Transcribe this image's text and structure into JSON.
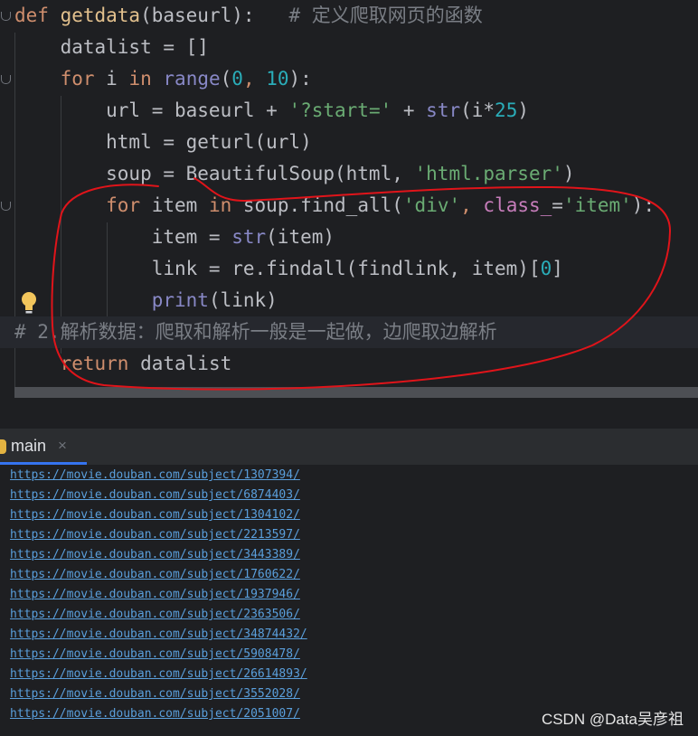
{
  "editor": {
    "lines": [
      [
        {
          "t": "def ",
          "c": "kw"
        },
        {
          "t": "getdata",
          "c": "fn"
        },
        {
          "t": "(baseurl):   ",
          "c": "param"
        },
        {
          "t": "# 定义爬取网页的函数",
          "c": "cm"
        }
      ],
      [
        {
          "t": "    datalist = []",
          "c": "param"
        }
      ],
      [
        {
          "t": "    ",
          "c": "param"
        },
        {
          "t": "for",
          "c": "kw"
        },
        {
          "t": " i ",
          "c": "param"
        },
        {
          "t": "in",
          "c": "kw"
        },
        {
          "t": " ",
          "c": "param"
        },
        {
          "t": "range",
          "c": "bi"
        },
        {
          "t": "(",
          "c": "param"
        },
        {
          "t": "0",
          "c": "num"
        },
        {
          "t": ", ",
          "c": "kw"
        },
        {
          "t": "10",
          "c": "num"
        },
        {
          "t": "):",
          "c": "param"
        }
      ],
      [
        {
          "t": "        url = baseurl + ",
          "c": "param"
        },
        {
          "t": "'?start='",
          "c": "str"
        },
        {
          "t": " + ",
          "c": "param"
        },
        {
          "t": "str",
          "c": "bi"
        },
        {
          "t": "(i*",
          "c": "param"
        },
        {
          "t": "25",
          "c": "num"
        },
        {
          "t": ")",
          "c": "param"
        }
      ],
      [
        {
          "t": "        html = geturl(url)",
          "c": "param"
        }
      ],
      [
        {
          "t": "        soup = BeautifulSoup(html, ",
          "c": "param"
        },
        {
          "t": "'html.parser'",
          "c": "str"
        },
        {
          "t": ")",
          "c": "param"
        }
      ],
      [
        {
          "t": "        ",
          "c": "param"
        },
        {
          "t": "for",
          "c": "kw"
        },
        {
          "t": " item ",
          "c": "param"
        },
        {
          "t": "in",
          "c": "kw"
        },
        {
          "t": " soup.find_all(",
          "c": "param"
        },
        {
          "t": "'div'",
          "c": "str"
        },
        {
          "t": ", ",
          "c": "kw"
        },
        {
          "t": "class_",
          "c": "attr"
        },
        {
          "t": "=",
          "c": "param"
        },
        {
          "t": "'item'",
          "c": "str"
        },
        {
          "t": "):",
          "c": "param"
        }
      ],
      [
        {
          "t": "            item = ",
          "c": "param"
        },
        {
          "t": "str",
          "c": "bi"
        },
        {
          "t": "(item)",
          "c": "param"
        }
      ],
      [
        {
          "t": "            link = re.findall(findlink, item)[",
          "c": "param"
        },
        {
          "t": "0",
          "c": "num"
        },
        {
          "t": "]",
          "c": "param"
        }
      ],
      [
        {
          "t": "            ",
          "c": "param"
        },
        {
          "t": "print",
          "c": "bi"
        },
        {
          "t": "(link)",
          "c": "param"
        }
      ],
      [
        {
          "t": "# 2.解析数据：爬取和解析一般是一起做，边爬取边解析",
          "c": "cm"
        }
      ],
      [
        {
          "t": "    ",
          "c": "param"
        },
        {
          "t": "return",
          "c": "kw"
        },
        {
          "t": " datalist",
          "c": "param"
        }
      ]
    ]
  },
  "run_panel": {
    "tab_label": "main",
    "close_glyph": "×"
  },
  "console": {
    "output": [
      "https://movie.douban.com/subject/1307394/",
      "https://movie.douban.com/subject/6874403/",
      "https://movie.douban.com/subject/1304102/",
      "https://movie.douban.com/subject/2213597/",
      "https://movie.douban.com/subject/3443389/",
      "https://movie.douban.com/subject/1760622/",
      "https://movie.douban.com/subject/1937946/",
      "https://movie.douban.com/subject/2363506/",
      "https://movie.douban.com/subject/34874432/",
      "https://movie.douban.com/subject/5908478/",
      "https://movie.douban.com/subject/26614893/",
      "https://movie.douban.com/subject/3552028/",
      "https://movie.douban.com/subject/2051007/"
    ]
  },
  "watermark": "CSDN @Data吴彦祖",
  "colors": {
    "keyword": "#cf8e6d",
    "function": "#e2c08d",
    "number": "#2aacb8",
    "string": "#6aab73",
    "comment": "#7a7e85",
    "builtin": "#8888c6",
    "link": "#5a9fdc",
    "annotation": "#e0141a"
  }
}
